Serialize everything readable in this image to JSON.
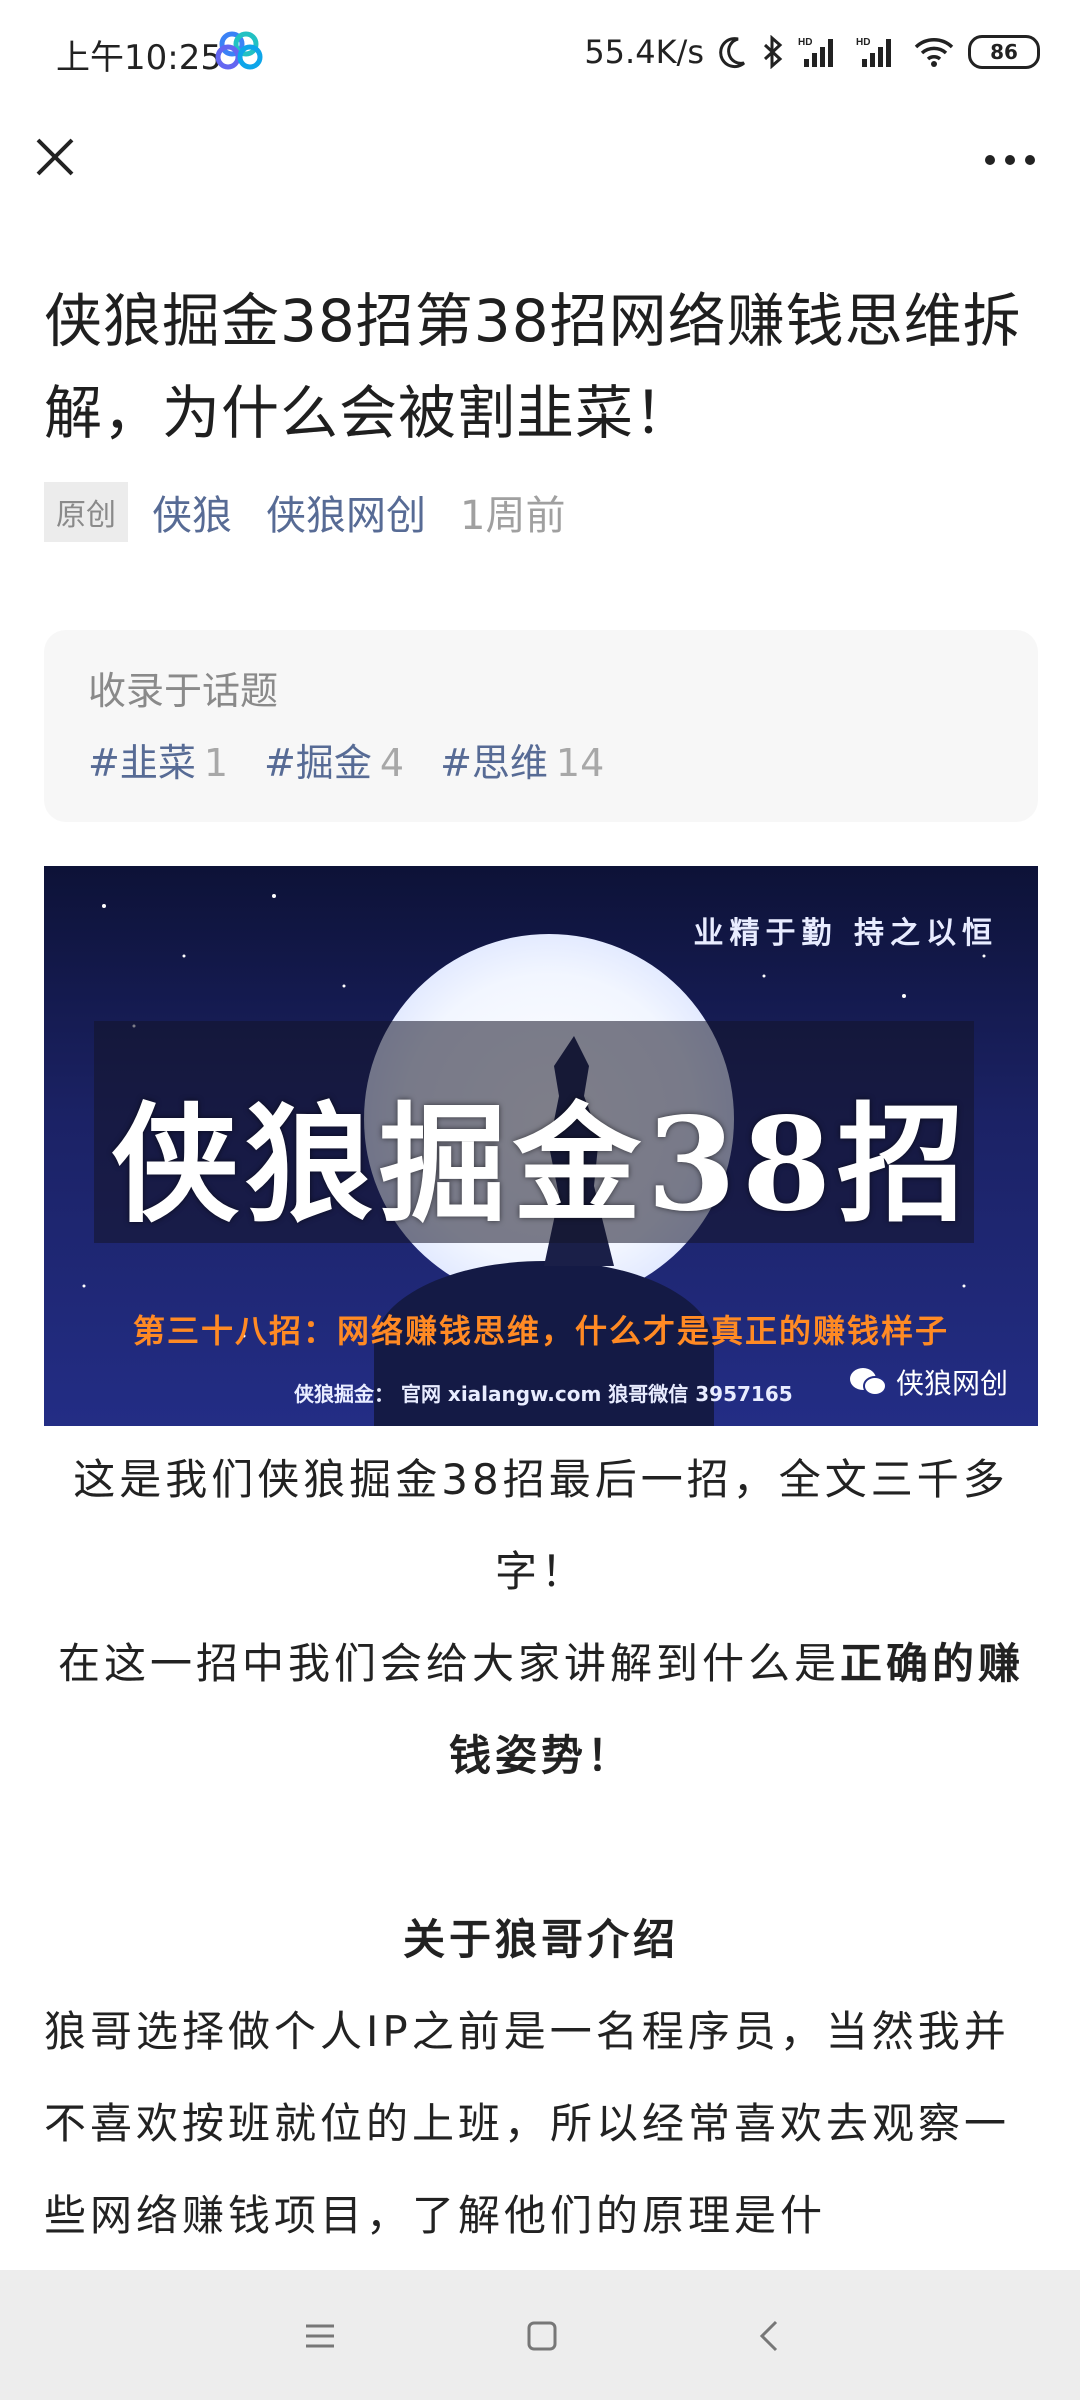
{
  "status_bar": {
    "time": "上午10:25",
    "network_speed": "55.4K/s",
    "battery": "86",
    "icons": [
      "cloud-app-icon",
      "moon-icon",
      "bluetooth-icon",
      "signal-hd-icon",
      "signal-hd-icon",
      "wifi-icon",
      "battery-icon"
    ]
  },
  "nav": {
    "close_icon": "close-icon",
    "more_icon": "more-icon"
  },
  "article": {
    "title": "侠狼掘金38招第38招网络赚钱思维拆解，为什么会被割韭菜！",
    "original_tag": "原创",
    "author": "侠狼",
    "account": "侠狼网创",
    "time": "1周前"
  },
  "topics": {
    "label": "收录于话题",
    "items": [
      {
        "name": "#韭菜",
        "count": "1"
      },
      {
        "name": "#掘金",
        "count": "4"
      },
      {
        "name": "#思维",
        "count": "14"
      }
    ]
  },
  "banner": {
    "motto": "业精于勤 持之以恒",
    "title": "侠狼掘金38招",
    "subtitle": "第三十八招：网络赚钱思维，什么才是真正的赚钱样子",
    "footer": "侠狼掘金： 官网 xialangw.com 狼哥微信 3957165",
    "brand": "侠狼网创"
  },
  "body": {
    "p1": "这是我们侠狼掘金38招最后一招，全文三千多字！",
    "p2_normal": "在这一招中我们会给大家讲解到什么是",
    "p2_bold": "正确的赚钱姿势！",
    "heading": "关于狼哥介绍",
    "p3": "狼哥选择做个人IP之前是一名程序员，当然我并不喜欢按班就位的上班，所以经常喜欢去观察一些网络赚钱项目，了解他们的原理是什"
  },
  "system_nav": {
    "menu": "menu-icon",
    "home": "home-icon",
    "back": "back-icon"
  }
}
